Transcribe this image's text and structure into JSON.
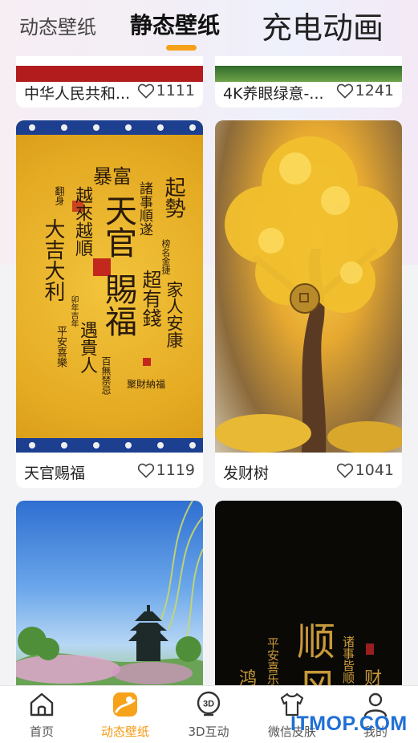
{
  "tabs": {
    "dynamic": "动态壁纸",
    "static": "静态壁纸",
    "charging": "充电动画"
  },
  "cards": [
    {
      "title": "中华人民共和...",
      "likes": "1111"
    },
    {
      "title": "4K养眼绿意-...",
      "likes": "1241"
    },
    {
      "title": "天官赐福",
      "likes": "1119"
    },
    {
      "title": "发财树",
      "likes": "1041"
    }
  ],
  "art": {
    "tianguan": {
      "top": "暴富",
      "main1": "天官",
      "main2": "賜福",
      "left_col1": "越來越順",
      "left_col2": "大吉大利",
      "left_small1": "翻身",
      "left_small2": "卯年吉年",
      "left_small3": "平安喜樂",
      "right_col1": "起勢",
      "right_col2": "諸事順遂",
      "right_col3": "超有錢",
      "right_col4": "家人安康",
      "right_small1": "榜名金捷",
      "mid_col": "遇貴人",
      "bottom_small1": "百無禁忌",
      "bottom_small2": "聚財納福"
    },
    "shunfeng": {
      "line1": "顺",
      "line2": "风",
      "left": "平安喜乐",
      "right": "诸事皆顺",
      "far_left": "鸿",
      "far_right": "财"
    }
  },
  "bottom_nav": [
    {
      "label": "首页",
      "icon": "home-icon"
    },
    {
      "label": "动态壁纸",
      "icon": "wallpaper-icon"
    },
    {
      "label": "3D互动",
      "icon": "3d-icon"
    },
    {
      "label": "微信皮肤",
      "icon": "shirt-icon"
    },
    {
      "label": "我的",
      "icon": "user-icon"
    }
  ],
  "watermark": "ITMOP.COM",
  "colors": {
    "accent": "#f6a21a",
    "active_nav": "#f39a12",
    "watermark": "#1f6fd6"
  }
}
